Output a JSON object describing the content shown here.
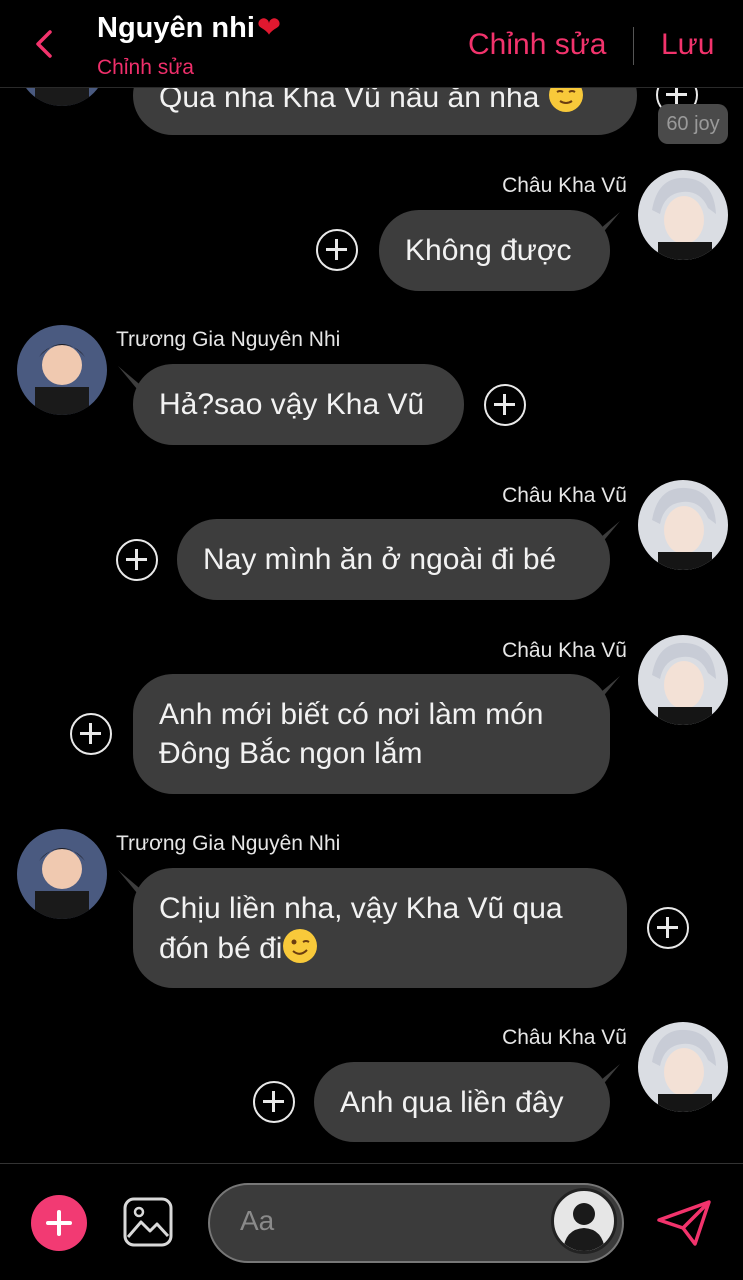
{
  "header": {
    "title": "Nguyên nhi",
    "heart": "❤",
    "subtitle": "Chỉnh sửa",
    "edit_label": "Chỉnh sửa",
    "save_label": "Lưu"
  },
  "messages": [
    {
      "side": "left",
      "sender": "",
      "text": "Qua nha Kha Vũ nấu ăn nha",
      "reaction": "60 joy"
    },
    {
      "side": "right",
      "sender": "Châu Kha Vũ",
      "text": "Không được"
    },
    {
      "side": "left",
      "sender": "Trương Gia Nguyên Nhi",
      "text": "Hả?sao vậy Kha Vũ"
    },
    {
      "side": "right",
      "sender": "Châu Kha Vũ",
      "text": "Nay mình ăn ở ngoài đi bé"
    },
    {
      "side": "right",
      "sender": "Châu Kha Vũ",
      "line1": "Anh mới biết có nơi làm món",
      "line2": "Đông Bắc ngon lắm"
    },
    {
      "side": "left",
      "sender": "Trương Gia Nguyên Nhi",
      "line1": "Chịu liền nha, vậy Kha Vũ qua",
      "line2": "đón bé đi"
    },
    {
      "side": "right",
      "sender": "Châu Kha Vũ",
      "text": "Anh qua liền đây"
    }
  ],
  "composer": {
    "placeholder": "Aa"
  },
  "icons": {
    "back": "chevron-left-icon",
    "add": "plus-icon",
    "image": "image-icon",
    "send": "send-icon",
    "react": "add-reaction-icon"
  },
  "colors": {
    "accent": "#f2336c",
    "bubble": "#3d3d3d",
    "background": "#000000",
    "heart": "#e0182f"
  }
}
